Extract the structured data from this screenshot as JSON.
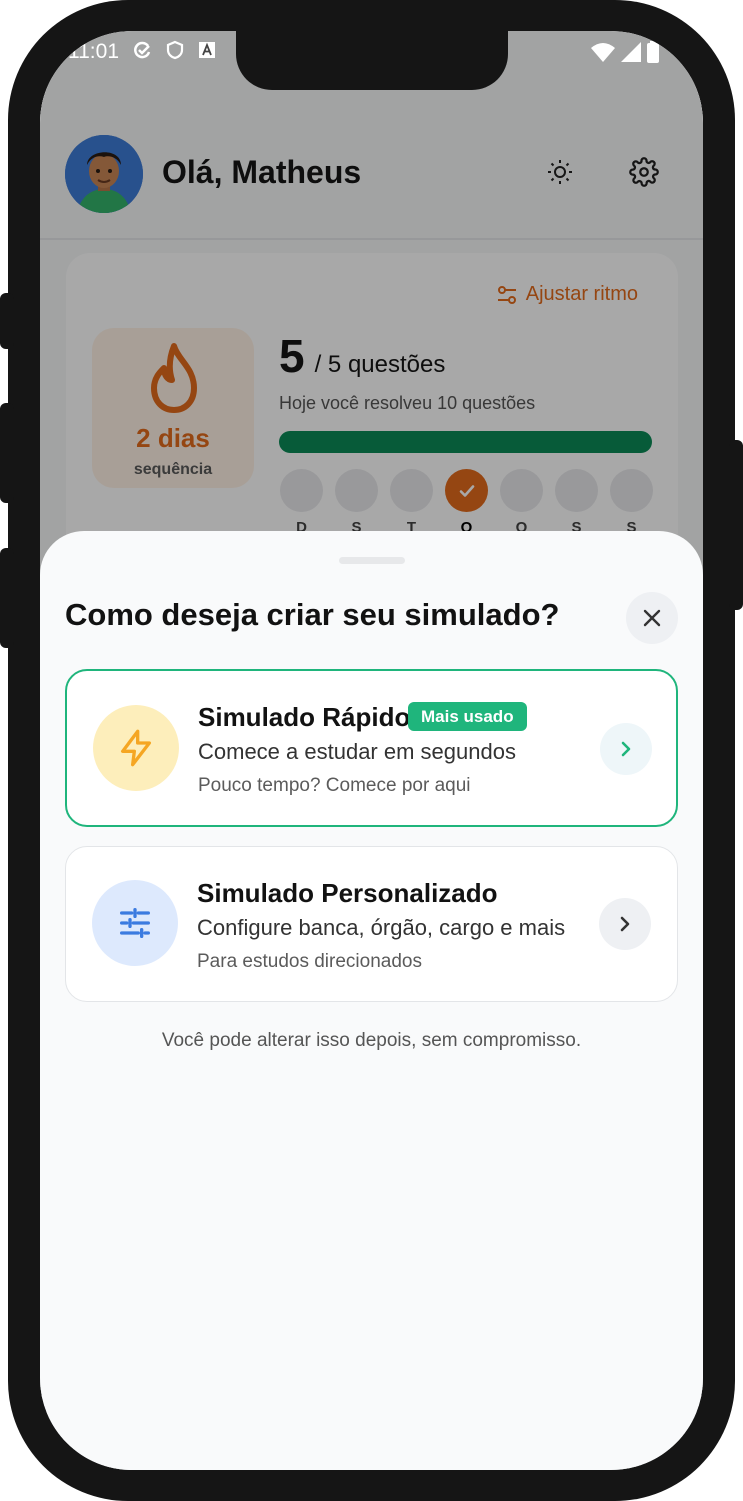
{
  "status_bar": {
    "time": "11:01",
    "left_icons": [
      "sync-check-icon",
      "shield-icon",
      "font-a-icon"
    ],
    "right_icons": [
      "wifi-icon",
      "signal-icon",
      "battery-icon"
    ]
  },
  "header": {
    "greeting": "Olá, Matheus",
    "theme_icon": "sun-icon",
    "settings_icon": "gear-icon"
  },
  "streak_card": {
    "adjust_label": "Ajustar ritmo",
    "streak_days": "2 dias",
    "streak_label": "sequência",
    "goal_done": "5",
    "goal_total": "/ 5 questões",
    "today_text": "Hoje você resolveu 10 questões",
    "progress": 1.0,
    "week_days": [
      "D",
      "S",
      "T",
      "Q",
      "Q",
      "S",
      "S"
    ],
    "active_day_index": 3
  },
  "sheet": {
    "title": "Como deseja criar seu simulado?",
    "options": [
      {
        "title": "Simulado Rápido",
        "badge": "Mais usado",
        "description": "Comece a estudar em segundos",
        "hint": "Pouco tempo? Comece por aqui",
        "icon": "lightning-icon"
      },
      {
        "title": "Simulado Personalizado",
        "description": "Configure banca, órgão, cargo e mais",
        "hint": "Para estudos direcionados",
        "icon": "sliders-icon"
      }
    ],
    "footnote": "Você pode alterar isso depois, sem compromisso."
  },
  "colors": {
    "accent_green": "#1fb57c",
    "accent_orange": "#e36b1c",
    "progress_green": "#0c8a57",
    "icon_yellow": "#f5a623",
    "icon_blue": "#3b7be0"
  }
}
